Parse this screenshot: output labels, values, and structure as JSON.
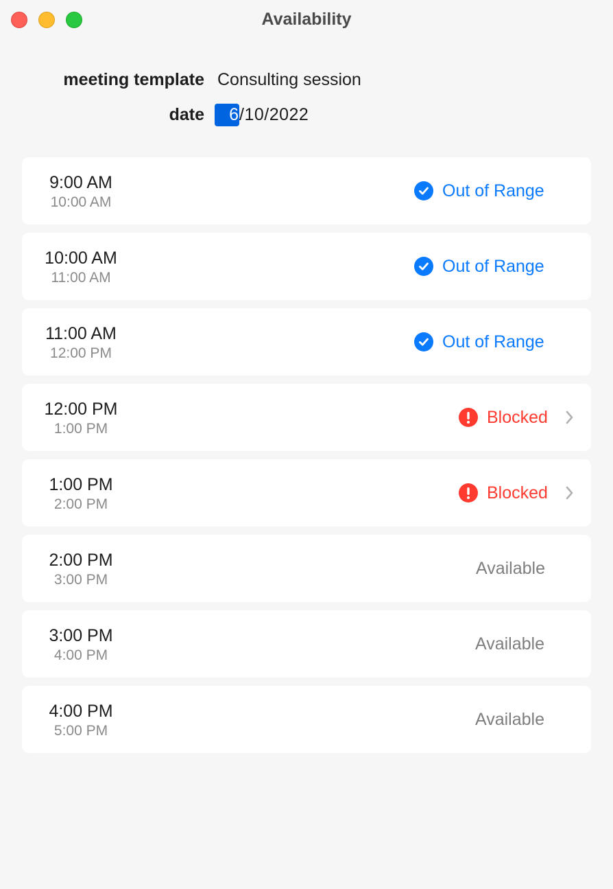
{
  "window": {
    "title": "Availability"
  },
  "form": {
    "template_label": "meeting template",
    "template_value": "Consulting session",
    "date_label": "date",
    "date_month": "6",
    "date_rest": "/10/2022"
  },
  "slots": [
    {
      "start": "9:00 AM",
      "end": "10:00 AM",
      "status": "Out of Range",
      "kind": "out-of-range",
      "icon": "checkmark-circle-icon"
    },
    {
      "start": "10:00 AM",
      "end": "11:00 AM",
      "status": "Out of Range",
      "kind": "out-of-range",
      "icon": "checkmark-circle-icon"
    },
    {
      "start": "11:00 AM",
      "end": "12:00 PM",
      "status": "Out of Range",
      "kind": "out-of-range",
      "icon": "checkmark-circle-icon"
    },
    {
      "start": "12:00 PM",
      "end": "1:00 PM",
      "status": "Blocked",
      "kind": "blocked",
      "icon": "exclamation-circle-icon"
    },
    {
      "start": "1:00 PM",
      "end": "2:00 PM",
      "status": "Blocked",
      "kind": "blocked",
      "icon": "exclamation-circle-icon"
    },
    {
      "start": "2:00 PM",
      "end": "3:00 PM",
      "status": "Available",
      "kind": "available"
    },
    {
      "start": "3:00 PM",
      "end": "4:00 PM",
      "status": "Available",
      "kind": "available"
    },
    {
      "start": "4:00 PM",
      "end": "5:00 PM",
      "status": "Available",
      "kind": "available"
    }
  ],
  "colors": {
    "accent_blue": "#0a7aff",
    "blocked_red": "#ff3b30",
    "available_gray": "#7e7e7e",
    "selection_blue": "#0064e1"
  }
}
